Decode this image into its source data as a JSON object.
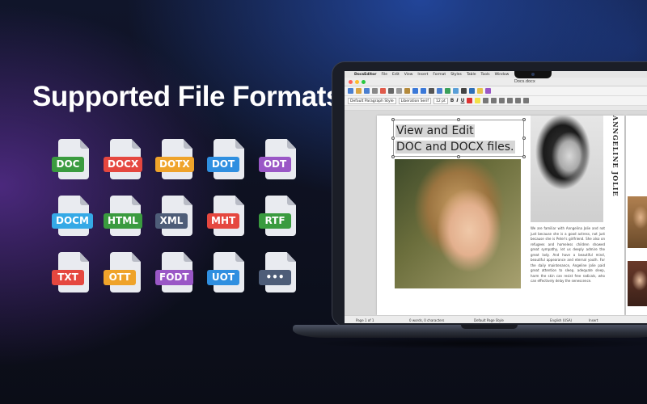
{
  "headline": "Supported File Formats",
  "formats": [
    {
      "label": "DOC",
      "color": "#3a9b3f"
    },
    {
      "label": "DOCX",
      "color": "#e5473f"
    },
    {
      "label": "DOTX",
      "color": "#efa32a"
    },
    {
      "label": "DOT",
      "color": "#2f8fe0"
    },
    {
      "label": "ODT",
      "color": "#9a57c6"
    },
    {
      "label": "DOCM",
      "color": "#35a9e6"
    },
    {
      "label": "HTML",
      "color": "#3a9b3f"
    },
    {
      "label": "XML",
      "color": "#4e5d78"
    },
    {
      "label": "MHT",
      "color": "#e5473f"
    },
    {
      "label": "RTF",
      "color": "#3a9b3f"
    },
    {
      "label": "TXT",
      "color": "#e5473f"
    },
    {
      "label": "OTT",
      "color": "#efa32a"
    },
    {
      "label": "FODT",
      "color": "#9a57c6"
    },
    {
      "label": "UOT",
      "color": "#2f8fe0"
    },
    {
      "label": "•••",
      "color": "#4e5d78"
    }
  ],
  "app": {
    "menu": [
      "DocsEditor",
      "File",
      "Edit",
      "View",
      "Insert",
      "Format",
      "Styles",
      "Table",
      "Tools",
      "Window"
    ],
    "window_title": "Docs.docx",
    "paragraph_style": "Default Paragraph Style",
    "font_name": "Liberation Serif",
    "font_size": "12 pt",
    "textbox_line1": "View and Edit",
    "textbox_line2": "DOC and DOCX files.",
    "vertical_title": "ANNGELINE JOLIE",
    "body_text": "We are familiar with Anngelina Jolie and not just because she is a good actress, not just because she is Peter's girlfriend. She also on refugees and homeless children showed great sympathy, let us deeply admire the great lady. And have a beautiful mind, beautiful appearance and eternal youth. For the daily maintenance, Angeline Jolie paid great attention to sleep, adequate sleep, harm the skin can resist free radicals, who can effectively delay the senescence.",
    "status": {
      "page": "Page 1 of 1",
      "words": "0 words, 0 characters",
      "page_style": "Default Page Style",
      "language": "English (USA)",
      "mode": "Insert"
    }
  }
}
